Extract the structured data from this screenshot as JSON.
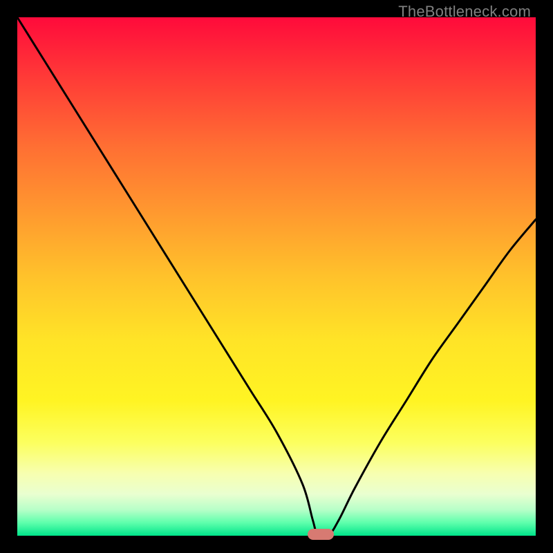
{
  "watermark": "TheBottleneck.com",
  "chart_data": {
    "type": "line",
    "title": "",
    "xlabel": "",
    "ylabel": "",
    "xlim": [
      0,
      100
    ],
    "ylim": [
      0,
      100
    ],
    "grid": false,
    "series": [
      {
        "name": "bottleneck-curve",
        "x": [
          0,
          5,
          10,
          15,
          20,
          25,
          30,
          35,
          40,
          45,
          50,
          55,
          57,
          58,
          60,
          62,
          65,
          70,
          75,
          80,
          85,
          90,
          95,
          100
        ],
        "values": [
          100,
          92,
          84,
          76,
          68,
          60,
          52,
          44,
          36,
          28,
          20,
          10,
          3,
          0,
          0,
          3,
          9,
          18,
          26,
          34,
          41,
          48,
          55,
          61
        ]
      }
    ],
    "annotations": [
      {
        "name": "optimal-marker",
        "x": 58.5,
        "y": 0,
        "color": "#d77a72"
      }
    ],
    "background_gradient": {
      "top": "#ff0a3b",
      "bottom": "#00e48a",
      "meaning": "red=high bottleneck, green=low bottleneck"
    }
  }
}
